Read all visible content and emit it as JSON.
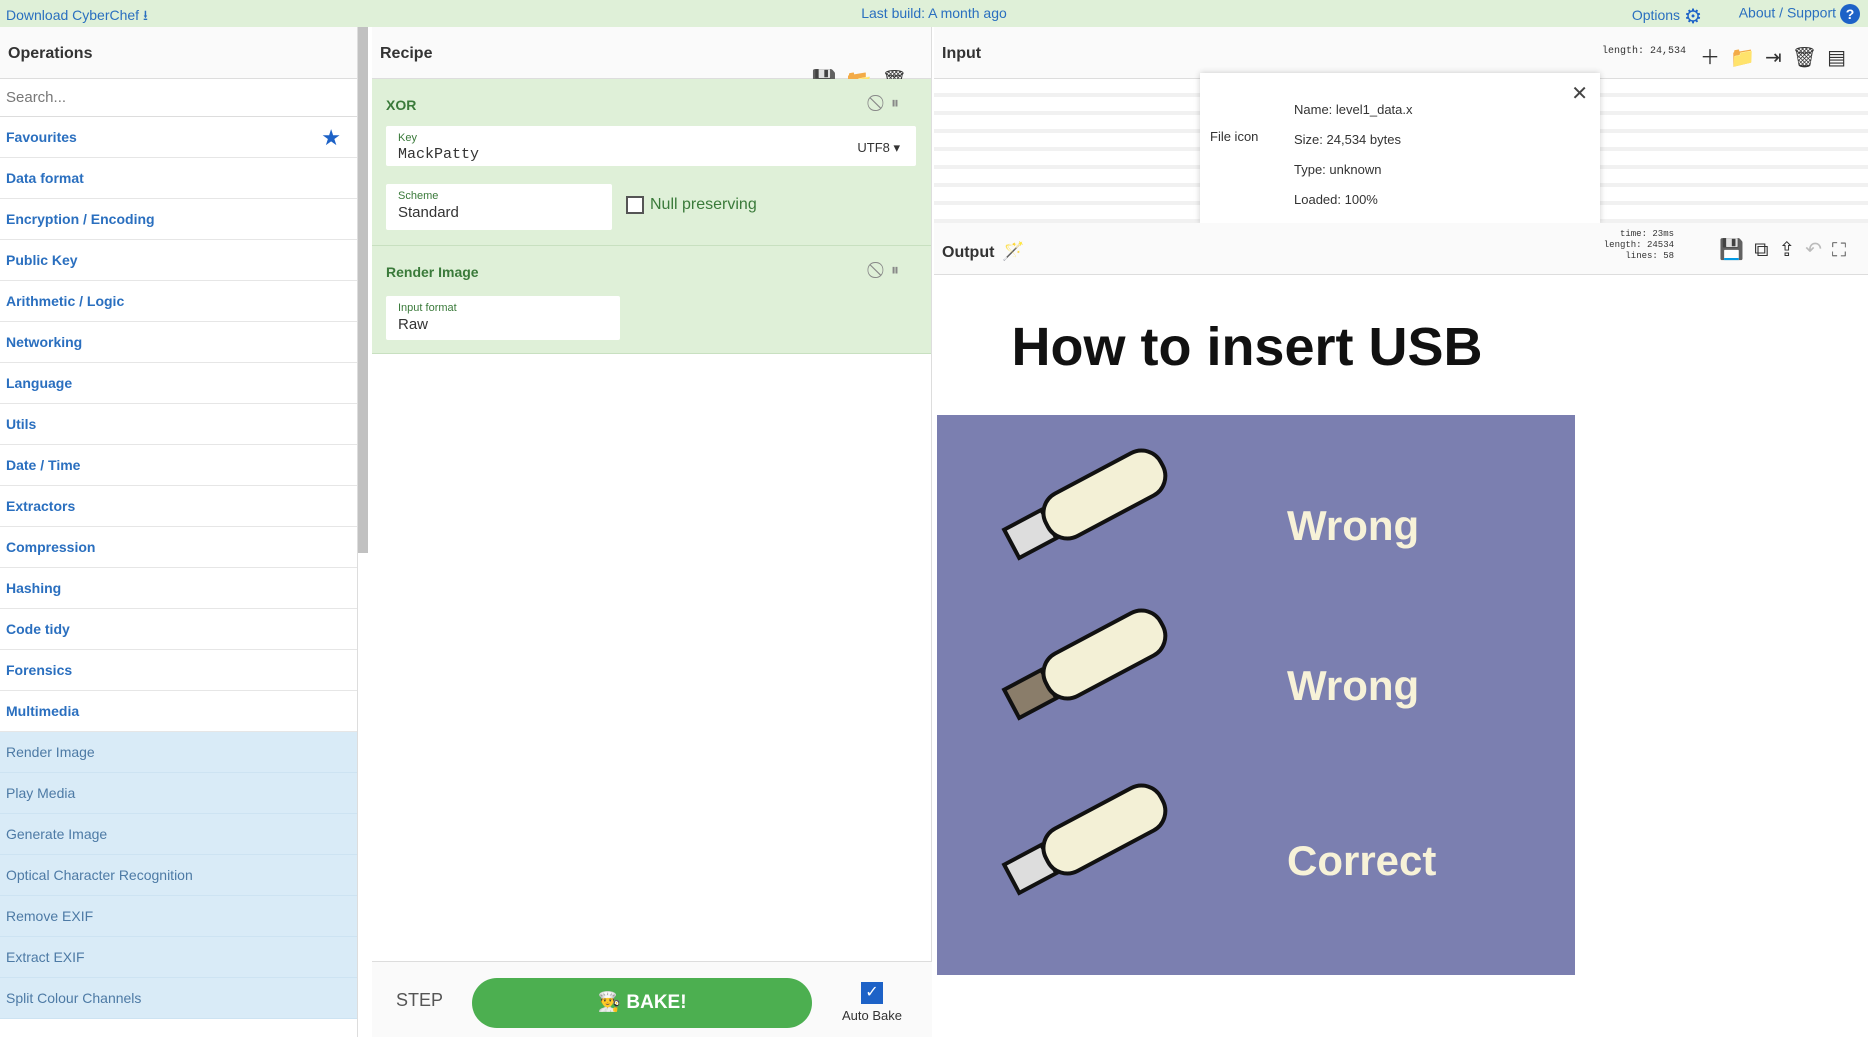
{
  "topbar": {
    "download": "Download CyberChef",
    "last_build": "Last build: A month ago",
    "options": "Options",
    "about": "About / Support"
  },
  "operations": {
    "title": "Operations",
    "search_placeholder": "Search...",
    "categories": [
      "Favourites",
      "Data format",
      "Encryption / Encoding",
      "Public Key",
      "Arithmetic / Logic",
      "Networking",
      "Language",
      "Utils",
      "Date / Time",
      "Extractors",
      "Compression",
      "Hashing",
      "Code tidy",
      "Forensics",
      "Multimedia"
    ],
    "items": [
      "Render Image",
      "Play Media",
      "Generate Image",
      "Optical Character Recognition",
      "Remove EXIF",
      "Extract EXIF",
      "Split Colour Channels"
    ]
  },
  "recipe": {
    "title": "Recipe",
    "xor": {
      "title": "XOR",
      "key_label": "Key",
      "key_value": "MackPatty",
      "encoding": "UTF8",
      "scheme_label": "Scheme",
      "scheme_value": "Standard",
      "null_label": "Null preserving"
    },
    "render": {
      "title": "Render Image",
      "format_label": "Input format",
      "format_value": "Raw"
    },
    "step": "STEP",
    "bake": "BAKE!",
    "autobake": "Auto Bake"
  },
  "input": {
    "title": "Input",
    "length": "length: 24,534",
    "file": {
      "icon_alt": "File icon",
      "name": "Name: level1_data.x",
      "size": "Size: 24,534 bytes",
      "type": "Type: unknown",
      "loaded": "Loaded: 100%"
    }
  },
  "output": {
    "title": "Output",
    "time": "time:  23ms",
    "length": "length: 24534",
    "lines": "lines:    58",
    "image": {
      "heading": "How to insert USB",
      "labels": [
        "Wrong",
        "Wrong",
        "Correct"
      ],
      "bg": "#7b7fb0"
    }
  },
  "colors": {
    "accent": "#1d62c7",
    "green": "#4caf50",
    "recipe_bg": "#dff0d8"
  }
}
